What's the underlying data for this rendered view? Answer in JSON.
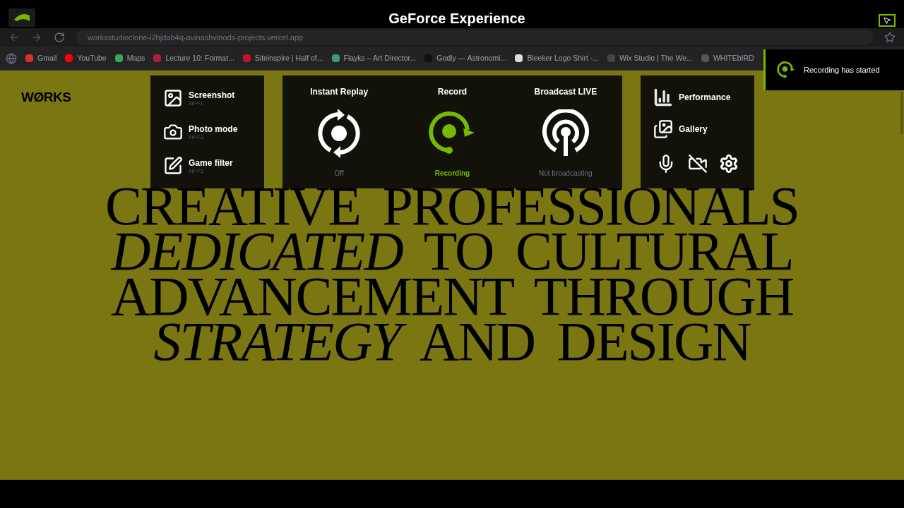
{
  "app_bar": {
    "title": "GeForce Experience"
  },
  "browser": {
    "url": "worksstudioclone-i2hjdab4q-avinashvinods-projects.vercel.app",
    "bookmarks": [
      {
        "label": "Gmail",
        "color": "#d93025"
      },
      {
        "label": "YouTube",
        "color": "#ff0000"
      },
      {
        "label": "Maps",
        "color": "#34a853"
      },
      {
        "label": "Lecture 10: Format...",
        "color": "#b01e3c"
      },
      {
        "label": "Siteinspire | Half of...",
        "color": "#c8102e"
      },
      {
        "label": "Flayks – Art Director...",
        "color": "#3a9b7a"
      },
      {
        "label": "Godly — Astronomi...",
        "color": "#111111"
      },
      {
        "label": "Bleeker Logo Shirt -...",
        "color": "#dddddd"
      },
      {
        "label": "Wix Studio | The We...",
        "color": "#444444"
      },
      {
        "label": "WHITEbIRD",
        "color": "#555555"
      }
    ]
  },
  "page": {
    "logo": "WØRKS",
    "headline": [
      "CREATIVE PROFESSIONALS",
      "*DEDICATED* TO CULTURAL",
      "ADVANCEMENT THROUGH",
      "*STRATEGY* AND DESIGN"
    ]
  },
  "overlay": {
    "capture": [
      {
        "kind": "screenshot",
        "label": "Screenshot",
        "shortcut": "Alt+F1"
      },
      {
        "kind": "photo",
        "label": "Photo mode",
        "shortcut": "Alt+F2"
      },
      {
        "kind": "filter",
        "label": "Game filter",
        "shortcut": "Alt+F3"
      }
    ],
    "modes": [
      {
        "kind": "replay",
        "label": "Instant Replay",
        "status": "Off",
        "active": false
      },
      {
        "kind": "record",
        "label": "Record",
        "status": "Recording",
        "active": true
      },
      {
        "kind": "broadcast",
        "label": "Broadcast LIVE",
        "status": "Not broadcasting",
        "active": false
      }
    ],
    "links": [
      {
        "kind": "performance",
        "label": "Performance"
      },
      {
        "kind": "gallery",
        "label": "Gallery"
      }
    ],
    "toggles": [
      {
        "kind": "microphone",
        "on": true
      },
      {
        "kind": "camera",
        "on": false
      },
      {
        "kind": "settings"
      }
    ]
  },
  "notification": {
    "text": "Recording has started"
  }
}
